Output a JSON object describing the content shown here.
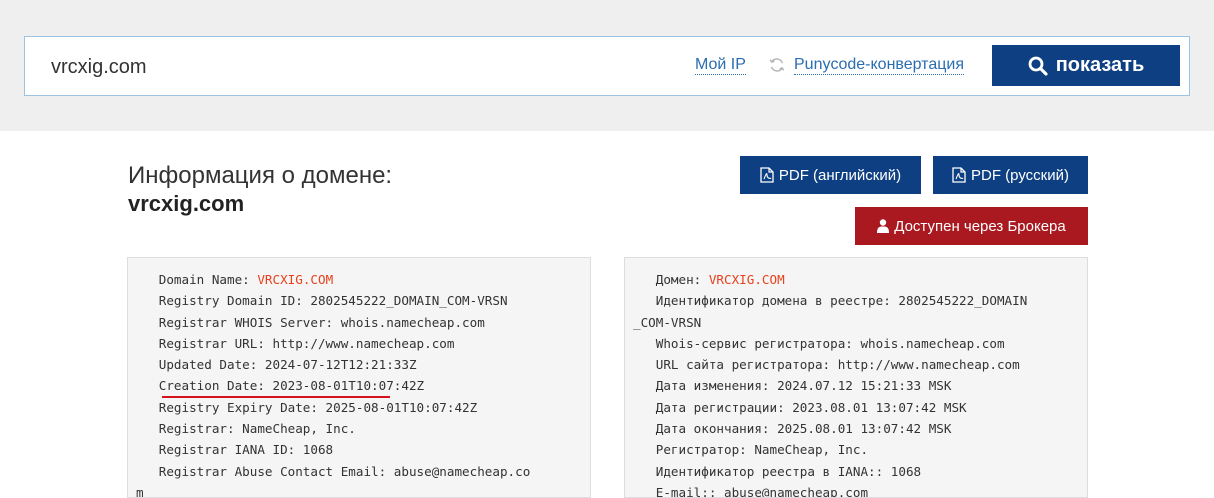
{
  "search": {
    "value": "vrcxig.com",
    "my_ip_label": "Мой IP",
    "punycode_label": "Punycode-конвертация",
    "show_button_label": "показать"
  },
  "header": {
    "title": "Информация о домене:",
    "domain": "vrcxig.com",
    "pdf_en_label": "PDF (английский)",
    "pdf_ru_label": "PDF (русский)",
    "broker_label": "Доступен через Брокера"
  },
  "whois_en": {
    "domain_name_key": "Domain Name: ",
    "domain_name_value": "VRCXIG.COM",
    "lines": [
      "Registry Domain ID: 2802545222_DOMAIN_COM-VRSN",
      "Registrar WHOIS Server: whois.namecheap.com",
      "Registrar URL: http://www.namecheap.com",
      "Updated Date: 2024-07-12T12:21:33Z",
      "Creation Date: 2023-08-01T10:07:42Z",
      "Registry Expiry Date: 2025-08-01T10:07:42Z",
      "Registrar: NameCheap, Inc.",
      "Registrar IANA ID: 1068",
      "Registrar Abuse Contact Email: abuse@namecheap.co",
      "m"
    ]
  },
  "whois_ru": {
    "domain_name_key": "Домен: ",
    "domain_name_value": "VRCXIG.COM",
    "lines": [
      "Идентификатор домена в реестре: 2802545222_DOMAIN",
      "_COM-VRSN",
      "Whois-сервис регистратора: whois.namecheap.com",
      "URL сайта регистратора: http://www.namecheap.com",
      "Дата изменения: 2024.07.12 15:21:33 MSK",
      "Дата регистрации: 2023.08.01 13:07:42 MSK",
      "Дата окончания: 2025.08.01 13:07:42 MSK",
      "Регистратор: NameCheap, Inc.",
      "Идентификатор реестра в IANA:: 1068",
      "E-mail:: abuse@namecheap.com"
    ]
  },
  "colors": {
    "primary": "#0d3f82",
    "broker": "#a9191f",
    "highlight": "#e8401c",
    "annotation": "#d3141c"
  },
  "icons": [
    "refresh-icon",
    "search-icon",
    "pdf-icon",
    "user-icon"
  ]
}
